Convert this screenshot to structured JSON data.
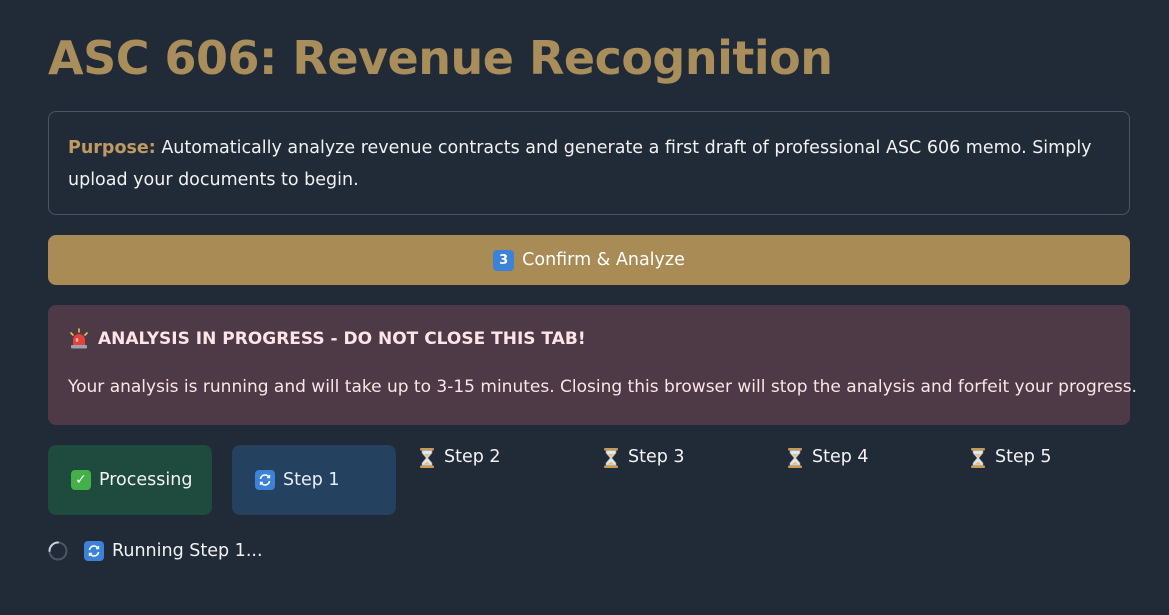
{
  "page": {
    "title": "ASC 606: Revenue Recognition"
  },
  "purpose": {
    "label": "Purpose:",
    "text": " Automatically analyze revenue contracts and generate a first draft of professional ASC 606 memo. Simply upload your documents to begin."
  },
  "analyze_button": {
    "icon": "keycap-3-icon",
    "icon_text": "3",
    "label": "Confirm & Analyze"
  },
  "warning": {
    "icon": "siren-icon",
    "title": "ANALYSIS IN PROGRESS - DO NOT CLOSE THIS TAB!",
    "text": "Your analysis is running and will take up to 3-15 minutes. Closing this browser will stop the analysis and forfeit your progress."
  },
  "steps": [
    {
      "icon": "check-icon",
      "label": "Processing",
      "status": "done"
    },
    {
      "icon": "refresh-icon",
      "label": "Step 1",
      "status": "active"
    },
    {
      "icon": "hourglass-icon",
      "label": "Step 2",
      "status": "pending"
    },
    {
      "icon": "hourglass-icon",
      "label": "Step 3",
      "status": "pending"
    },
    {
      "icon": "hourglass-icon",
      "label": "Step 4",
      "status": "pending"
    },
    {
      "icon": "hourglass-icon",
      "label": "Step 5",
      "status": "pending"
    }
  ],
  "status": {
    "icon": "refresh-icon",
    "text": "Running Step 1..."
  },
  "colors": {
    "background": "#212b38",
    "accent": "#a88b55",
    "title": "#a98d5a",
    "warning_bg": "#4d3a46",
    "done_bg": "#1f4a3e",
    "active_bg": "#24415f"
  }
}
